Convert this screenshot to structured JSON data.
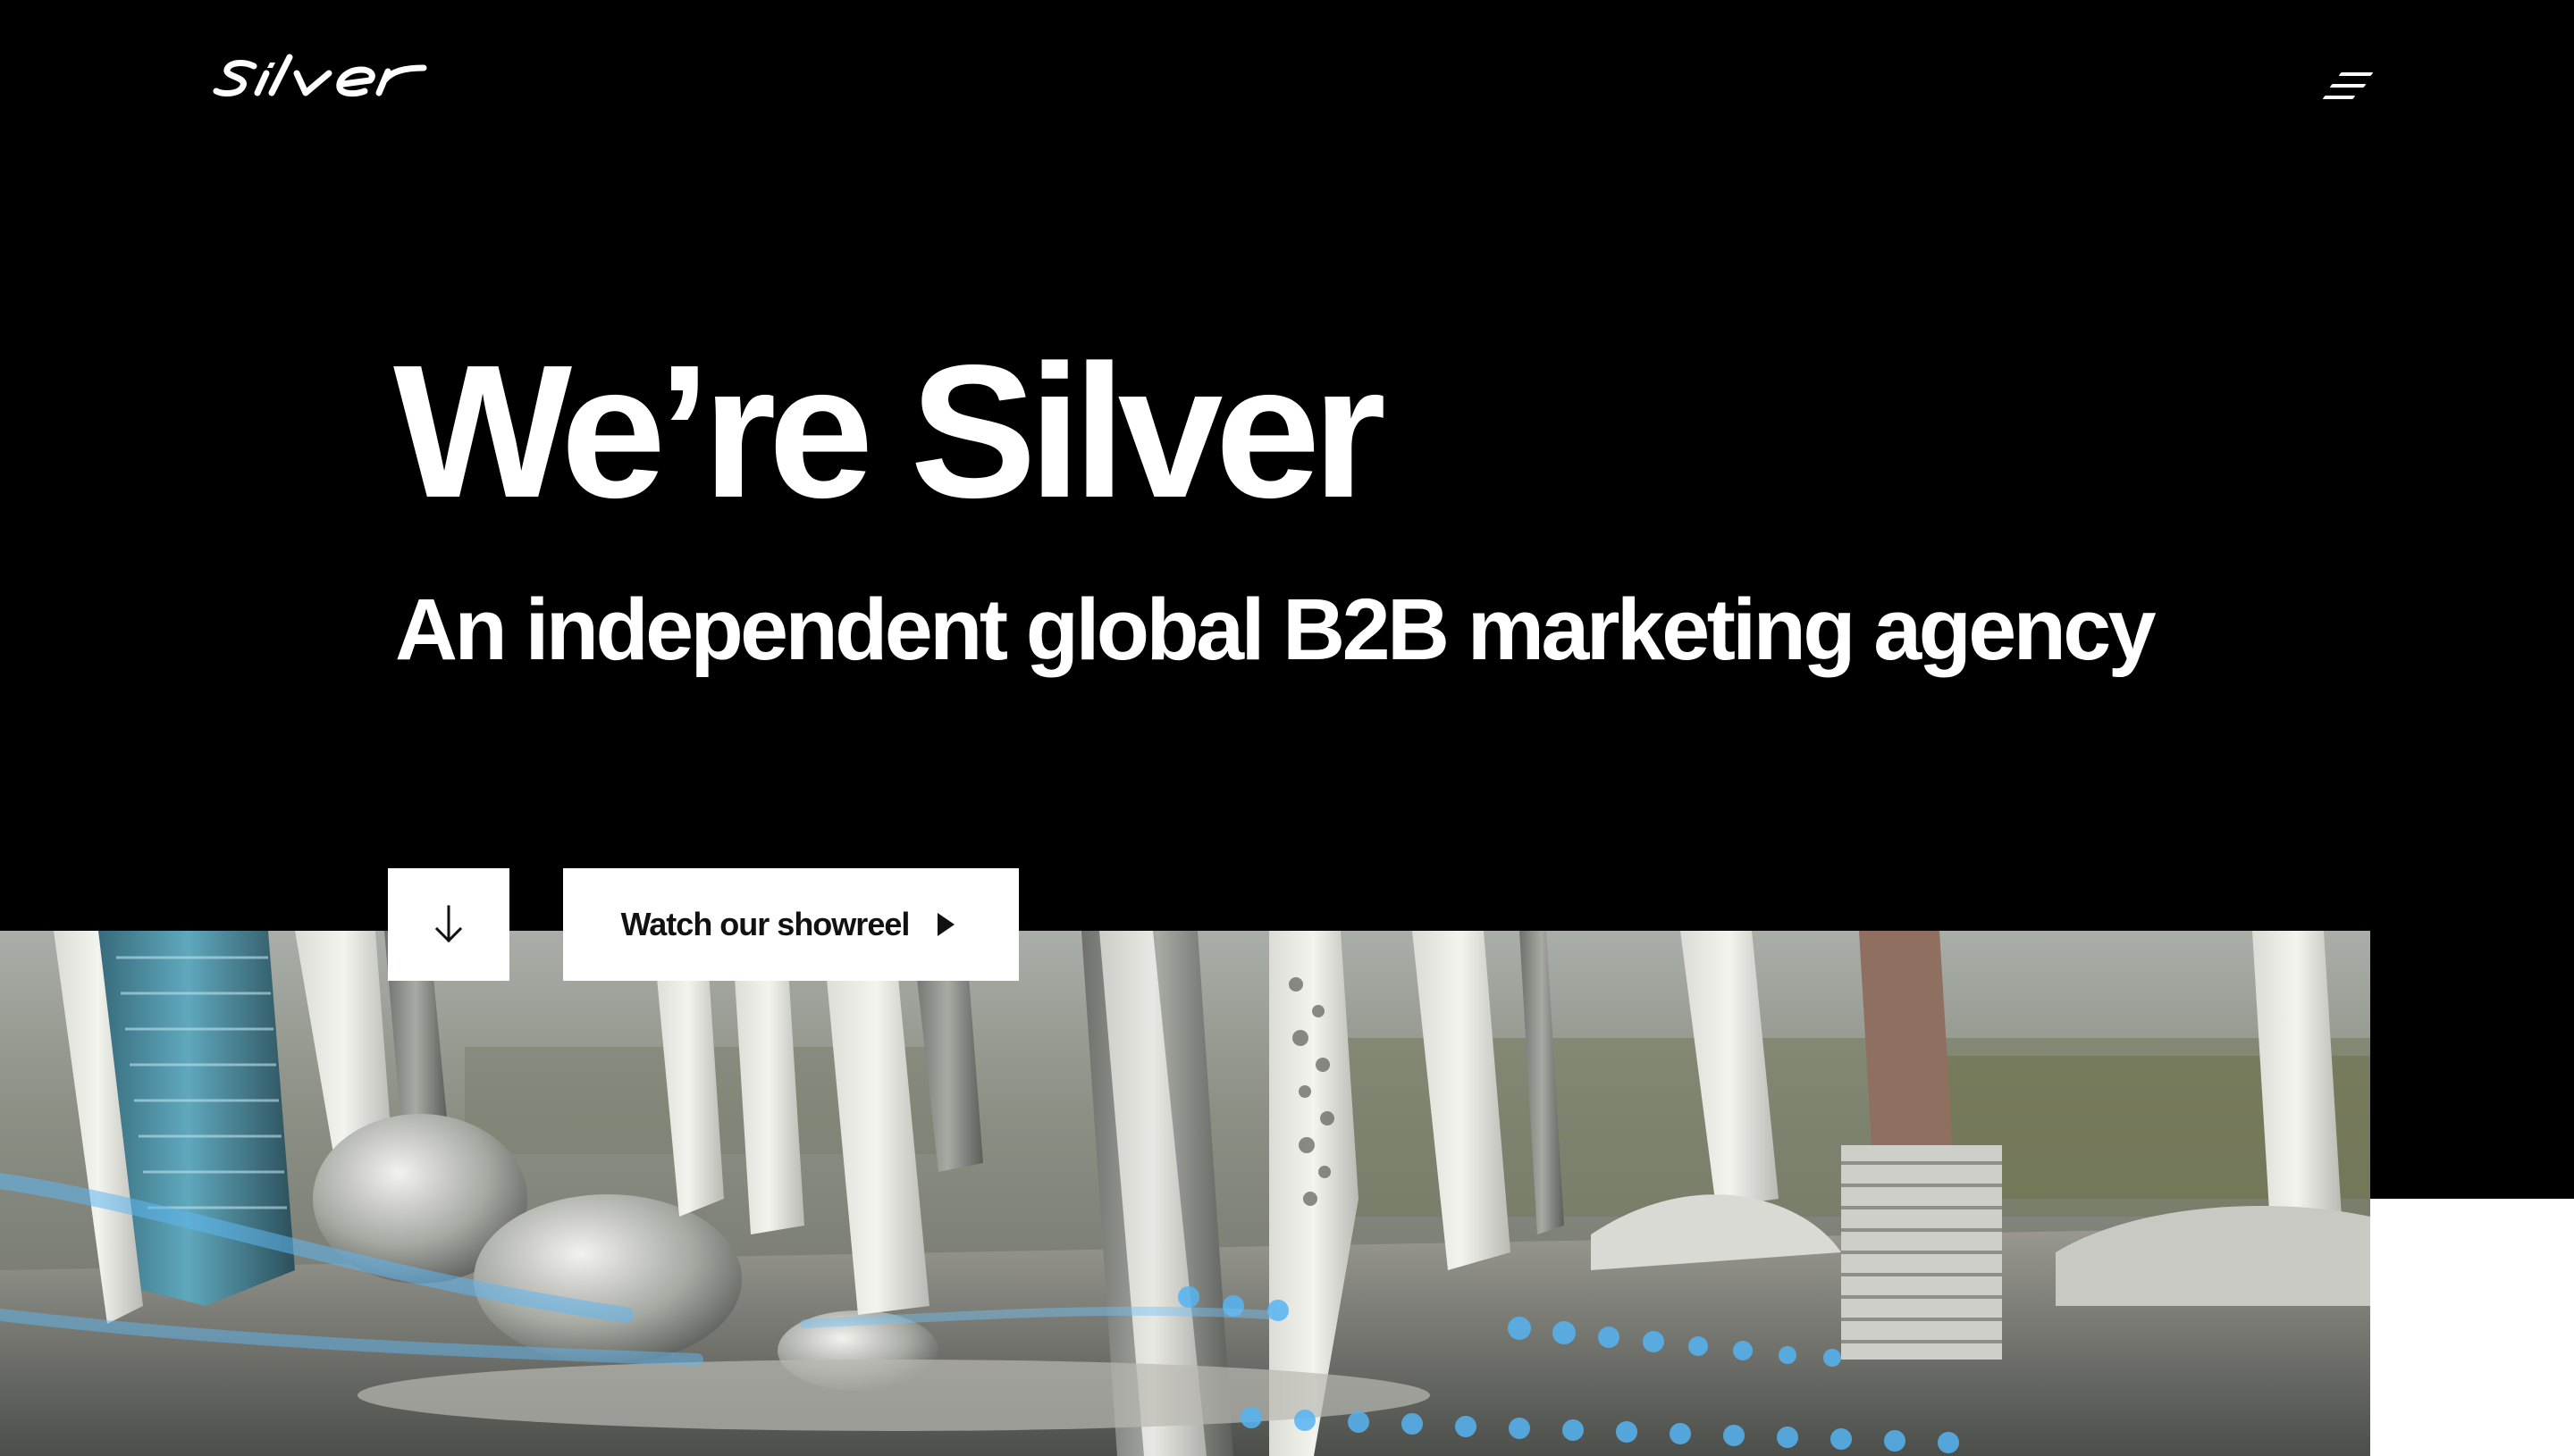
{
  "header": {
    "logo_text": "silver",
    "menu_icon": "hamburger-menu-icon"
  },
  "hero": {
    "title": "We’re Silver",
    "subtitle": "An independent global B2B marketing agency",
    "scroll_icon": "arrow-down-icon",
    "showreel_label": "Watch our showreel",
    "play_icon": "play-icon"
  },
  "colors": {
    "background": "#000000",
    "text": "#ffffff",
    "button_bg": "#ffffff",
    "button_text": "#111111",
    "accent_glow": "#4aa8e8"
  }
}
